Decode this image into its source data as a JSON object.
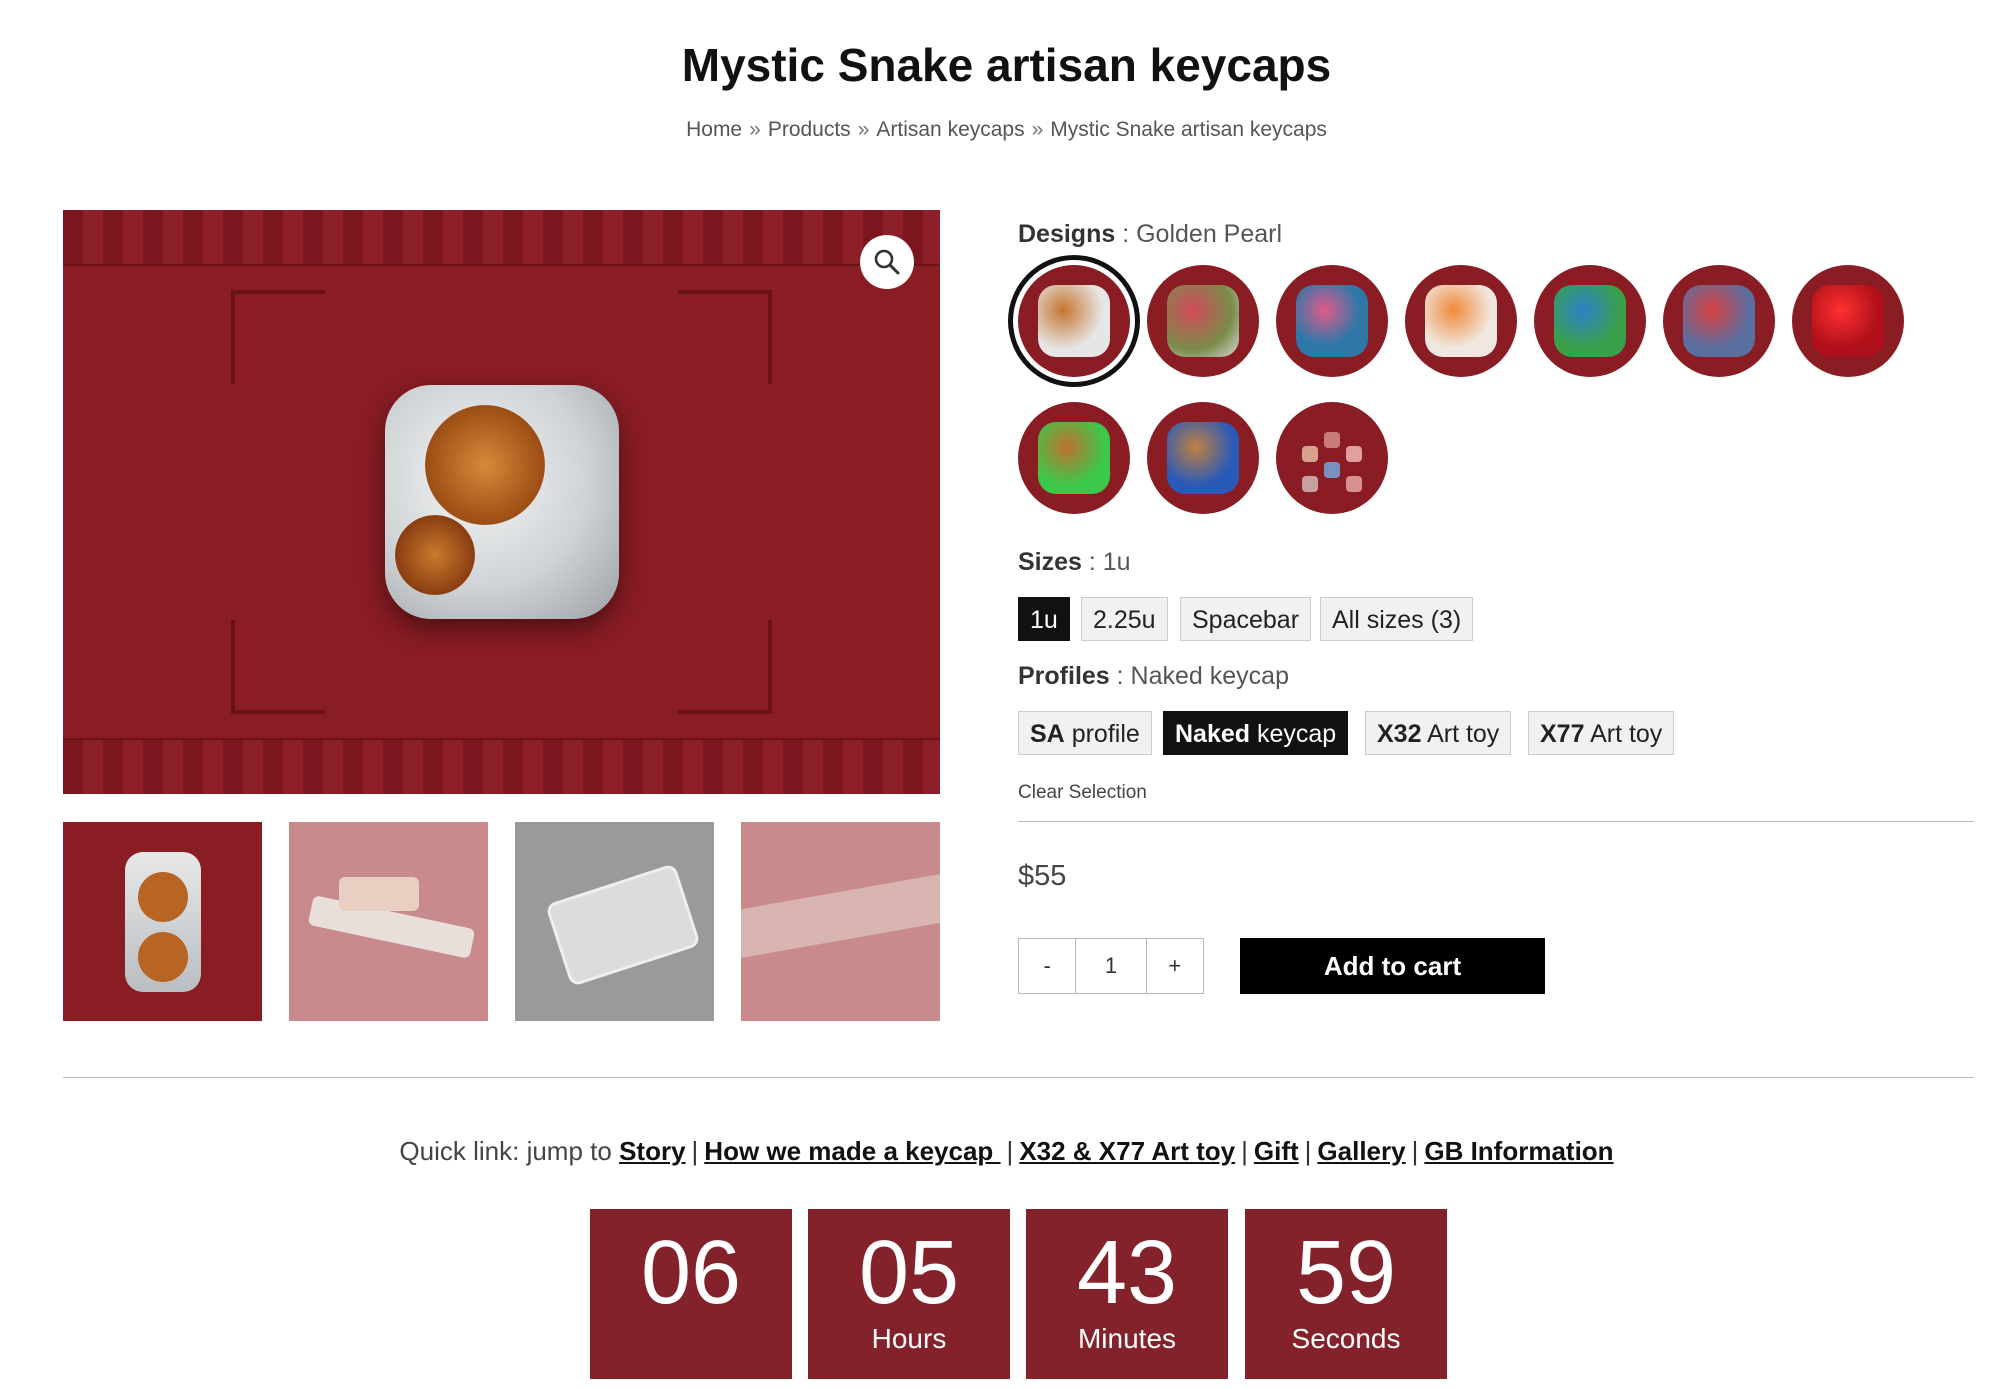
{
  "page": {
    "title": "Mystic Snake artisan keycaps",
    "breadcrumb": [
      "Home",
      "Products",
      "Artisan keycaps",
      "Mystic Snake artisan keycaps"
    ],
    "breadcrumb_separator": "»"
  },
  "gallery": {
    "zoom_icon": "magnifier-icon",
    "colors": {
      "bg": "#8a1c24"
    }
  },
  "designs": {
    "label": "Designs",
    "selected": "Golden Pearl",
    "swatch_count": 10
  },
  "sizes": {
    "label": "Sizes",
    "selected": "1u",
    "options": [
      "1u",
      "2.25u",
      "Spacebar",
      "All sizes (3)"
    ]
  },
  "profiles": {
    "label": "Profiles",
    "selected": "Naked keycap",
    "options": [
      {
        "bold": "SA",
        "rest": "profile"
      },
      {
        "bold": "Naked",
        "rest": "keycap"
      },
      {
        "bold": "X32",
        "rest": "Art toy"
      },
      {
        "bold": "X77",
        "rest": "Art toy"
      }
    ]
  },
  "clear_selection": "Clear Selection",
  "price": "$55",
  "quantity": {
    "minus": "-",
    "value": "1",
    "plus": "+"
  },
  "add_to_cart": "Add to cart",
  "quick_links": {
    "prefix": "Quick link: jump to",
    "links": [
      "Story",
      "How we made a keycap ",
      "X32 & X77 Art toy",
      "Gift",
      "Gallery",
      "GB Information"
    ]
  },
  "countdown": [
    {
      "value": "06",
      "unit": ""
    },
    {
      "value": "05",
      "unit": "Hours"
    },
    {
      "value": "43",
      "unit": "Minutes"
    },
    {
      "value": "59",
      "unit": "Seconds"
    }
  ],
  "accent_color": "#83222a"
}
